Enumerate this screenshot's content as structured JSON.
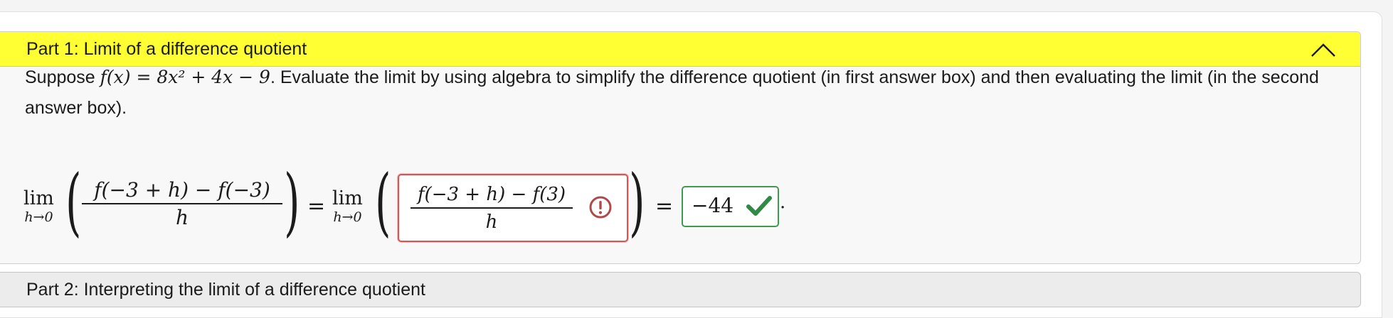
{
  "part1": {
    "title": "Part 1: Limit of a difference quotient",
    "prompt_before": "Suppose ",
    "function_math": "f(x) = 8x² + 4x − 9",
    "prompt_after": ". Evaluate the limit by using algebra to simplify the difference quotient (in first answer box) and then evaluating the limit (in the second answer box).",
    "limit_word": "lim",
    "limit_sub": "h→0",
    "left_numerator": "f(−3 + h) − f(−3)",
    "left_denominator": "h",
    "equals": "=",
    "answer1_numerator": "f(−3 + h) − f(3)",
    "answer1_denominator": "h",
    "answer1_status": "warning",
    "answer2_value": "−44",
    "answer2_status": "correct",
    "period": "."
  },
  "part2": {
    "title": "Part 2: Interpreting the limit of a difference quotient"
  },
  "colors": {
    "header_yellow": "#ffff33",
    "error_red": "#d85555",
    "correct_green": "#3d9a4e"
  },
  "icons": {
    "collapse": "chevron-up-icon",
    "warning": "exclamation-circle-icon",
    "correct": "checkmark-icon"
  }
}
